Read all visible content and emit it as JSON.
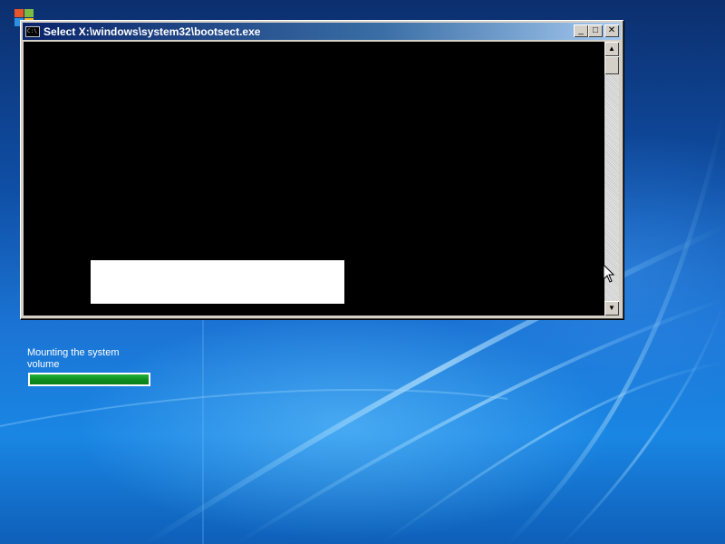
{
  "window": {
    "title": "Select X:\\windows\\system32\\bootsect.exe",
    "icon": "console-icon",
    "buttons": {
      "minimize_glyph": "_",
      "maximize_glyph": "□",
      "close_glyph": "✕"
    }
  },
  "scrollbar": {
    "up_glyph": "▲",
    "down_glyph": "▼"
  },
  "status": {
    "message": "Mounting the system volume",
    "progress": 1.0
  },
  "colors": {
    "progress_fill": "#0f8f20",
    "console_background": "#000000",
    "title_bar": "#0a246a"
  }
}
